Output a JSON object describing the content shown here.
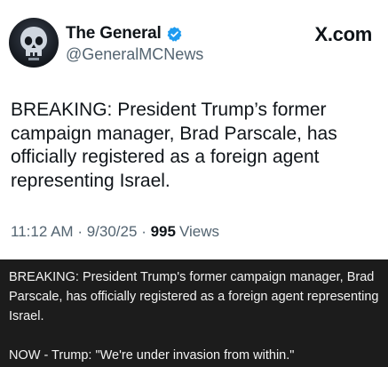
{
  "tweet": {
    "display_name": "The General",
    "handle": "@GeneralMCNews",
    "platform": "X.com",
    "text": "BREAKING: President Trump’s former campaign manager, Brad Parscale, has officially registered as a foreign agent representing Israel.",
    "time": "11:12 AM",
    "date": "9/30/25",
    "separator": "·",
    "views_count": "995",
    "views_label": "Views"
  },
  "caption": {
    "paragraph_1": "BREAKING: President Trump's former campaign manager, Brad Parscale, has officially registered as a foreign agent representing Israel.",
    "paragraph_2": "NOW - Trump: \"We're under invasion from within.\""
  },
  "colors": {
    "verified_badge": "#1d9bf0",
    "secondary_text": "#536471",
    "caption_bg": "#1c1c1c"
  },
  "icons": {
    "verified": "verified-badge-icon",
    "avatar": "skull-emblem"
  }
}
